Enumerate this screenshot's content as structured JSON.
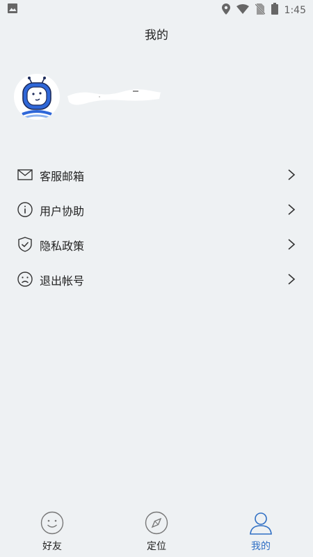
{
  "status_bar": {
    "time": "1:45",
    "icons": [
      "image-icon",
      "location-icon",
      "wifi-icon",
      "no-sim-icon",
      "battery-icon"
    ]
  },
  "header": {
    "title": "我的"
  },
  "profile": {
    "avatar_icon": "robot-avatar"
  },
  "menu": {
    "items": [
      {
        "label": "客服邮箱",
        "icon": "mail-icon"
      },
      {
        "label": "用户协助",
        "icon": "info-icon"
      },
      {
        "label": "隐私政策",
        "icon": "shield-check-icon"
      },
      {
        "label": "退出帐号",
        "icon": "sad-face-icon"
      }
    ]
  },
  "tabbar": {
    "active_color": "#2f6fc4",
    "tabs": [
      {
        "label": "好友",
        "icon": "smile-icon",
        "active": false
      },
      {
        "label": "定位",
        "icon": "compass-icon",
        "active": false
      },
      {
        "label": "我的",
        "icon": "user-icon",
        "active": true
      }
    ]
  }
}
